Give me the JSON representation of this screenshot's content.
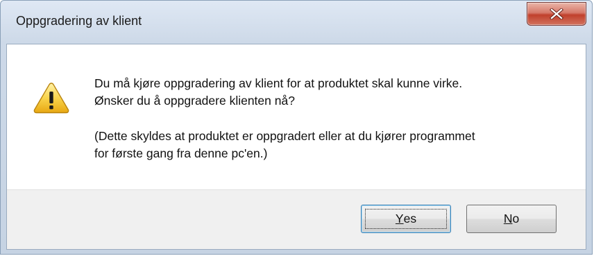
{
  "window": {
    "title": "Oppgradering av klient",
    "close_icon": "close-x-icon",
    "accent_color": "#c0402c"
  },
  "dialog": {
    "icon": "warning-icon",
    "message_line1": "Du må kjøre oppgradering av klient for at produktet skal kunne virke.",
    "message_line2": "Ønsker du å oppgradere klienten nå?",
    "detail_line1": "(Dette skyldes at produktet er oppgradert eller at du kjører programmet",
    "detail_line2": "for første gang fra denne pc'en.)"
  },
  "buttons": {
    "yes_mnemonic": "Y",
    "yes_rest": "es",
    "no_mnemonic": "N",
    "no_rest": "o"
  }
}
